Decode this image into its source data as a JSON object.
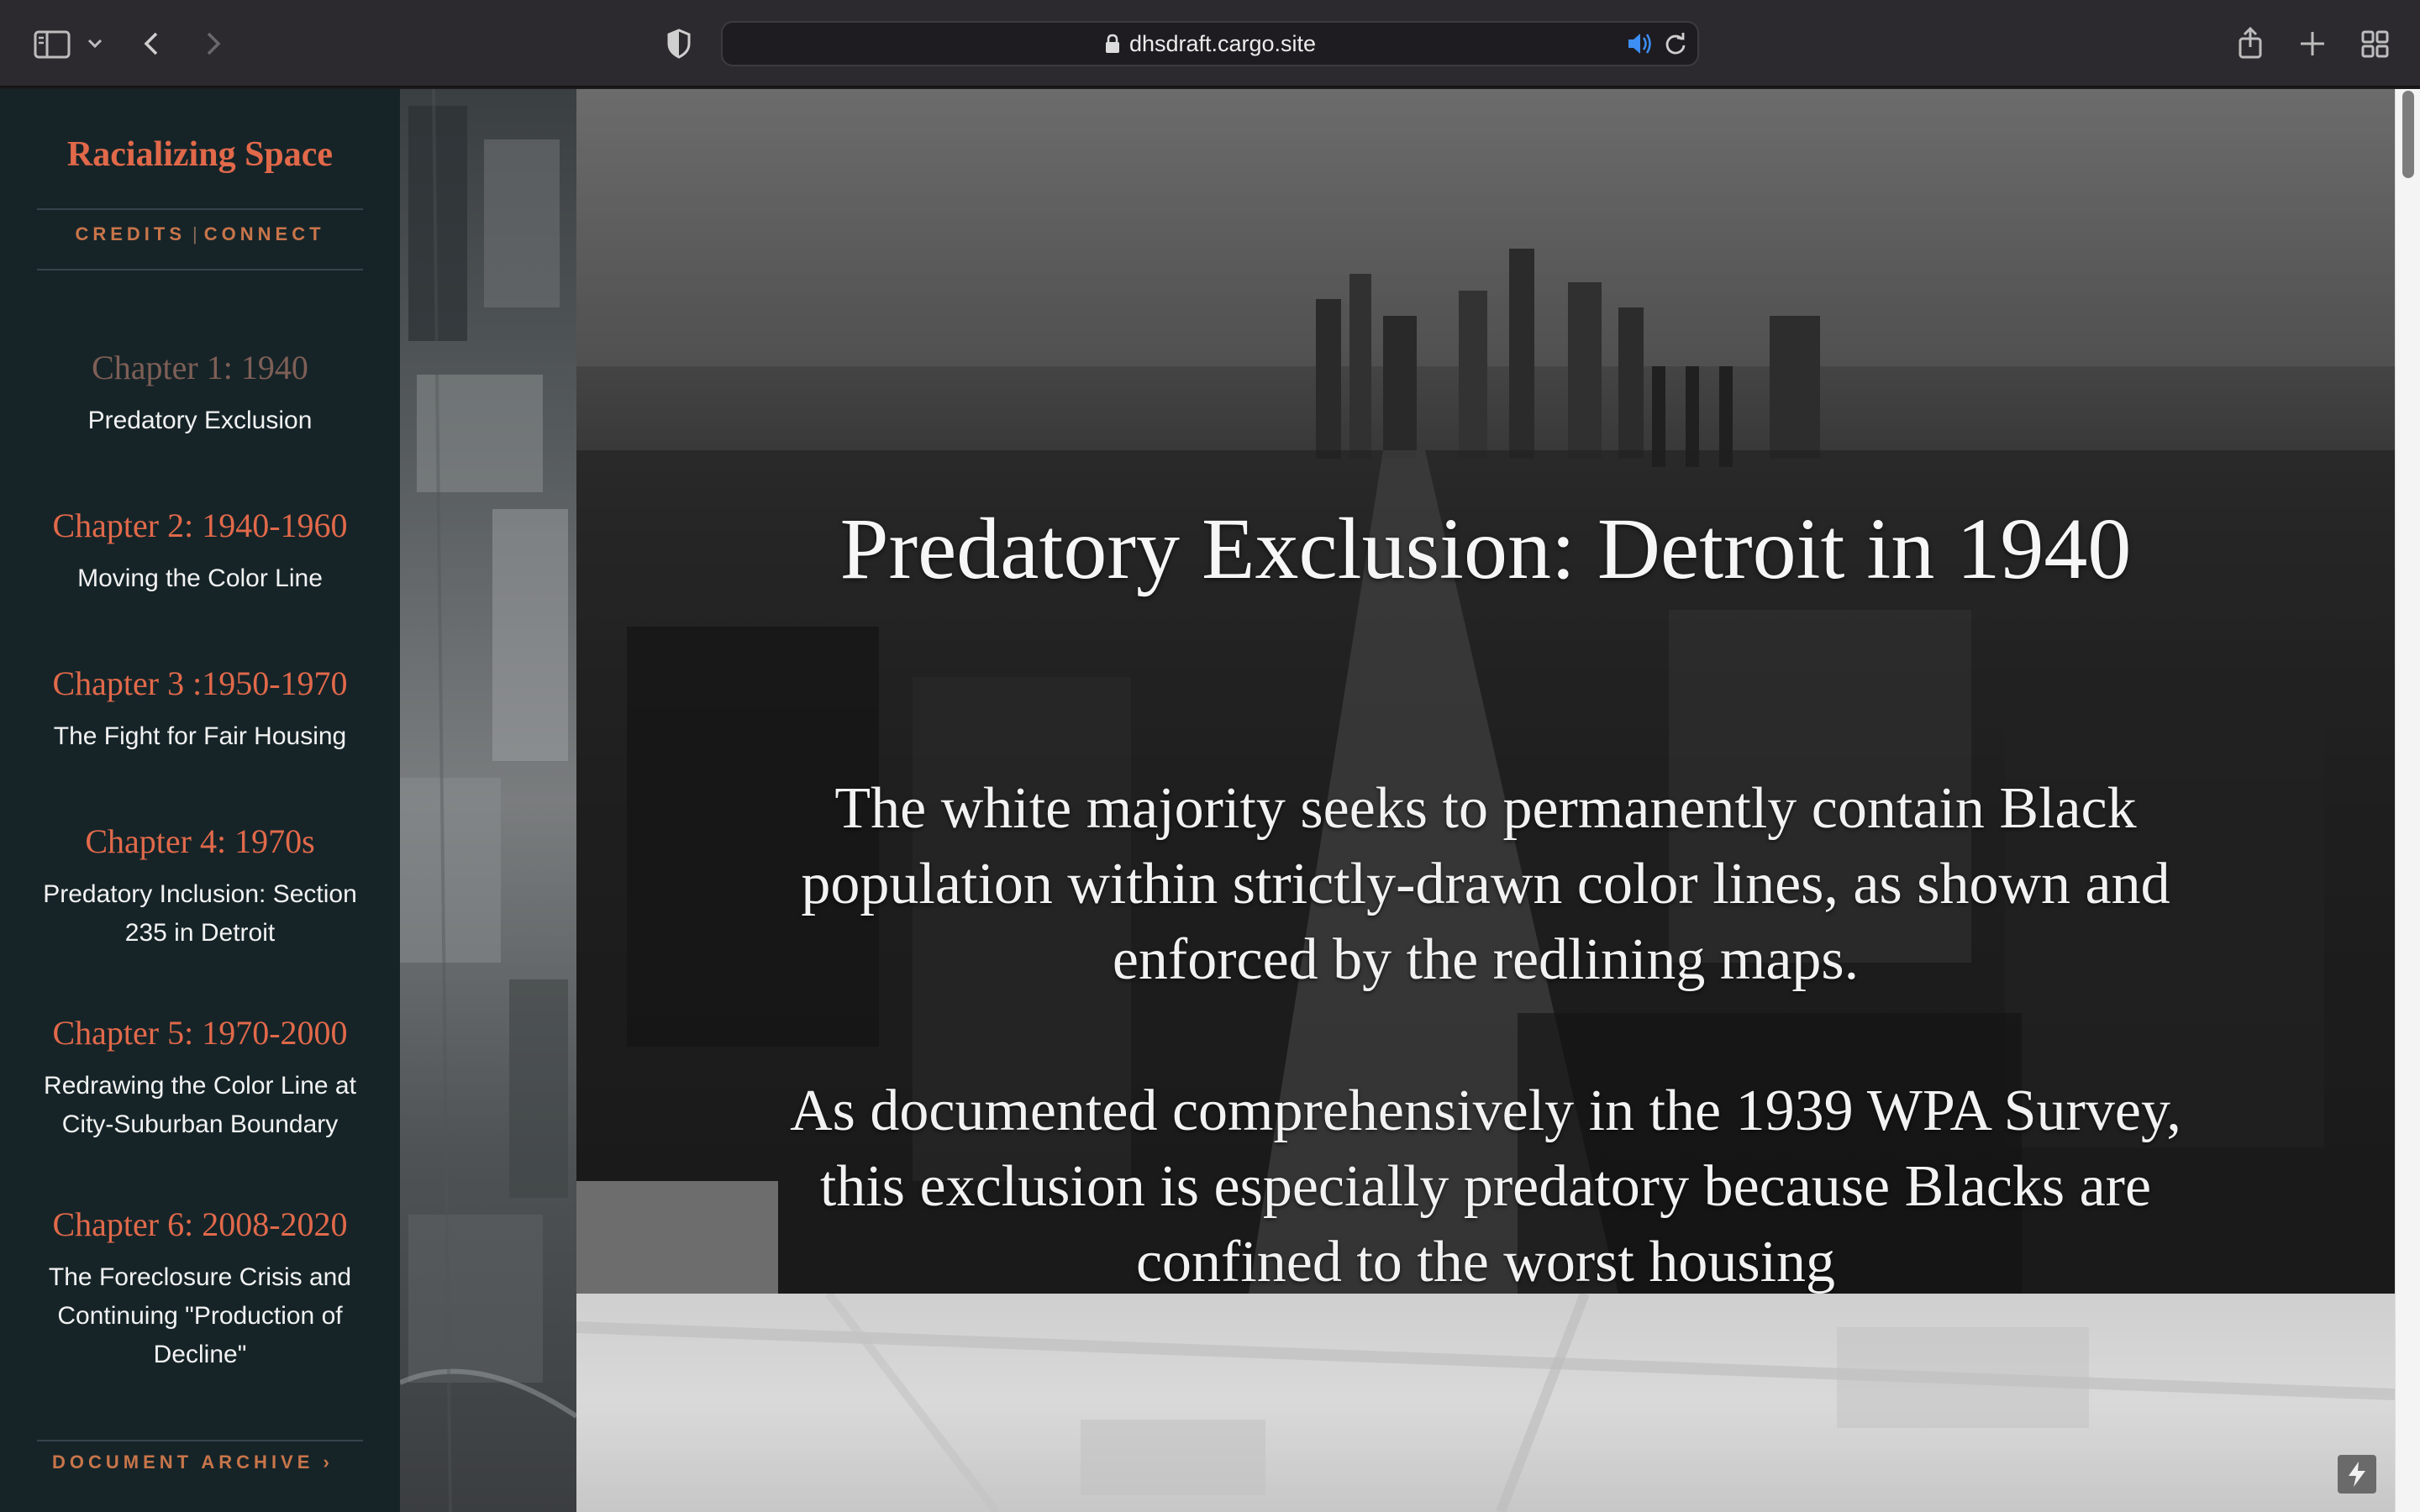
{
  "browser": {
    "url": "dhsdraft.cargo.site"
  },
  "sidebar": {
    "site_title": "Racializing Space",
    "subnav": {
      "credits": "CREDITS",
      "separator": "|",
      "connect": "CONNECT"
    },
    "chapters": [
      {
        "title": "Chapter 1: 1940",
        "subtitle": "Predatory Exclusion",
        "active": true
      },
      {
        "title": "Chapter 2: 1940-1960",
        "subtitle": "Moving the Color Line"
      },
      {
        "title": "Chapter 3 :1950-1970",
        "subtitle": "The Fight for Fair Housing"
      },
      {
        "title": "Chapter 4: 1970s",
        "subtitle": "Predatory Inclusion: Section 235 in Detroit"
      },
      {
        "title": "Chapter 5: 1970-2000",
        "subtitle": "Redrawing the Color Line at City-Suburban Boundary"
      },
      {
        "title": "Chapter 6: 2008-2020",
        "subtitle": "The Foreclosure Crisis and Continuing \"Production of Decline\""
      }
    ],
    "archive_label": "DOCUMENT ARCHIVE ›"
  },
  "hero": {
    "heading": "Predatory Exclusion: Detroit in 1940",
    "paragraph_1": "The white majority seeks to permanently contain Black population within strictly-drawn color lines, as shown and enforced by the redlining maps.",
    "paragraph_2": "As documented comprehensively in the 1939 WPA Survey, this exclusion is especially predatory because Blacks are confined to the worst housing"
  },
  "colors": {
    "accent": "#e1694a",
    "sidebar_bg": "#162428",
    "active_chapter": "#7e5f56"
  }
}
